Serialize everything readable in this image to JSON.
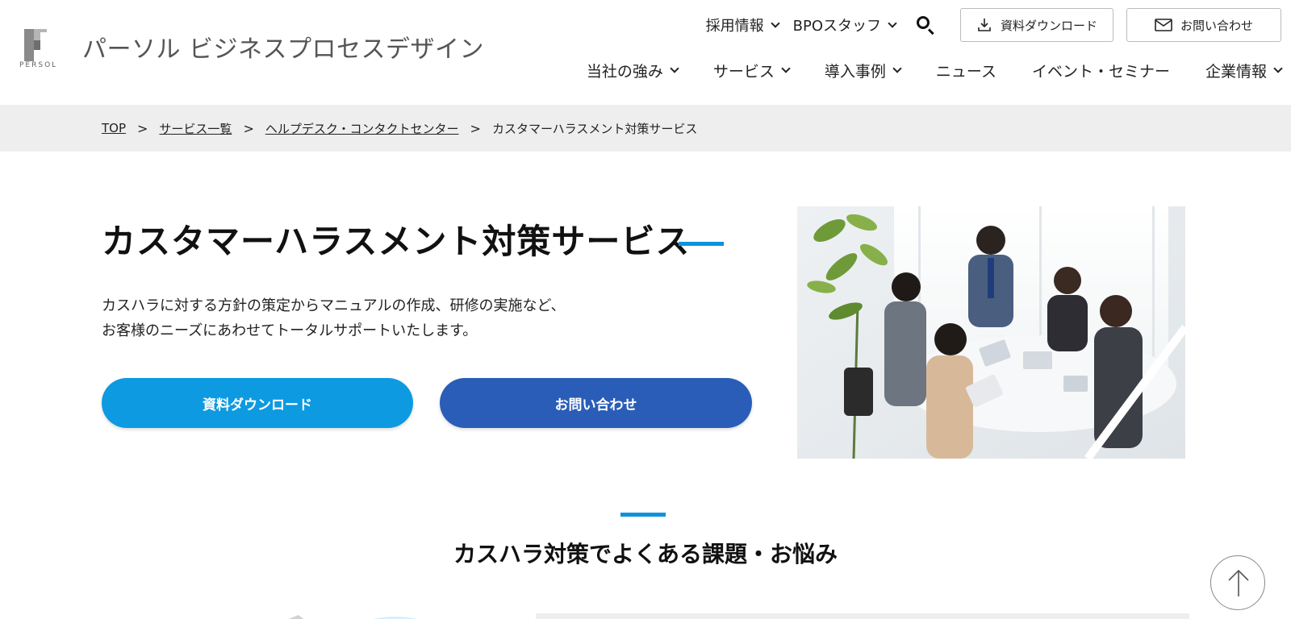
{
  "brand": {
    "name": "パーソル ビジネスプロセスデザイン",
    "sub": "PERSOL"
  },
  "util_nav": {
    "recruit": "採用情報",
    "bpo_staff": "BPOスタッフ",
    "download_btn": "資料ダウンロード",
    "contact_btn": "お問い合わせ"
  },
  "main_nav": {
    "strengths": "当社の強み",
    "services": "サービス",
    "cases": "導入事例",
    "news": "ニュース",
    "events": "イベント・セミナー",
    "company": "企業情報"
  },
  "breadcrumb": {
    "top": "TOP",
    "services_list": "サービス一覧",
    "helpdesk": "ヘルプデスク・コンタクトセンター",
    "current": "カスタマーハラスメント対策サービス",
    "separator": ">"
  },
  "hero": {
    "title": "カスタマーハラスメント対策サービス",
    "desc_line1": "カスハラに対する方針の策定からマニュアルの作成、研修の実施など、",
    "desc_line2": "お客様のニーズにあわせてトータルサポートいたします。",
    "download_label": "資料ダウンロード",
    "contact_label": "お問い合わせ"
  },
  "section": {
    "title": "カスハラ対策でよくある課題・お悩み"
  },
  "colors": {
    "accent": "#0d93dc",
    "download_button": "#0d9ae0",
    "contact_button": "#2a5db7",
    "breadcrumb_bg": "#eeeeee"
  }
}
